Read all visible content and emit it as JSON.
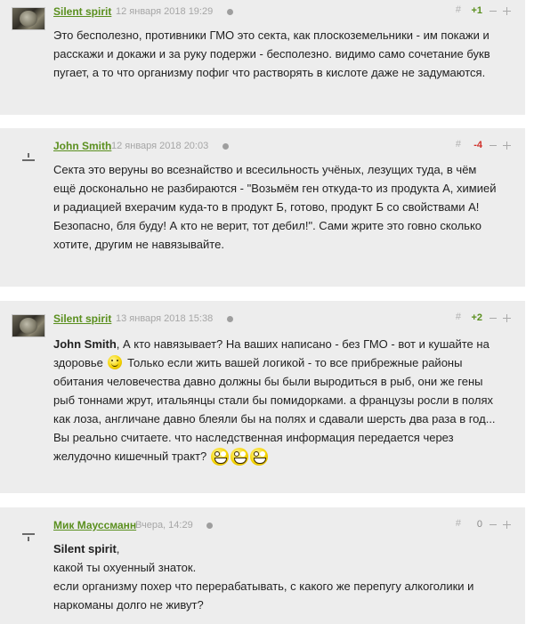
{
  "comments": [
    {
      "author": "Silent spirit",
      "date": "12 января 2018 19:29",
      "hash": "#",
      "score": "+1",
      "text": "Это бесполезно, противники ГМО это секта, как плоскоземельники - им покажи и расскажи и докажи и за руку подержи - бесполезно. видимо само сочетание букв пугает, а то что организму пофиг что растворять в кислоте даже не задумаются."
    },
    {
      "author": "John Smith",
      "date": "12 января 2018 20:03",
      "hash": "#",
      "score": "-4",
      "text": "Секта это веруны во всезнайство и всесильность учёных, лезущих туда, в чём ещё досконально не разбираются - \"Возьмём ген откуда-то из продукта А, химией и радиацией вхерачим куда-то в продукт Б, готово, продукт Б со свойствами А! Безопасно, бля буду! А кто не верит, тот дебил!\". Сами жрите это говно сколько хотите, другим не навязывайте."
    },
    {
      "author": "Silent spirit",
      "date": "13 января 2018 15:38",
      "hash": "#",
      "score": "+2",
      "mention": "John Smith",
      "text_a": ", А кто навязывает? На ваших написано - без ГМО - вот и кушайте на здоровье",
      "text_b": "Только если жить вашей логикой - то все прибрежные районы обитания человечества давно должны бы были выродиться в рыб, они же гены рыб тоннами жрут, итальянцы стали бы помидорками. а французы росли в полях как лоза, англичане давно блеяли бы на полях и сдавали шерсть два раза в год... Вы реально считаете. что наследственная информация передается через желудочно кишечный тракт?"
    },
    {
      "author": "Мик Мауссманн",
      "date": "Вчера, 14:29",
      "hash": "#",
      "score": "0",
      "mention": "Silent spirit",
      "mention_suffix": ",",
      "line2": "какой ты охуенный знаток.",
      "line3": "если организму похер что перерабатывать, с какого же перепугу алкоголики и наркоманы долго не живут?"
    }
  ],
  "icons": {
    "smile": "smile-emoticon-icon",
    "grin": "grin-emoticon-icon",
    "avatar_photo": "lemur-avatar-icon",
    "avatar_blank": "default-avatar-icon"
  },
  "colors": {
    "author": "#5a8f1e",
    "score_positive": "#5a8f1e",
    "score_negative": "#d0302a",
    "background": "#ededed"
  }
}
